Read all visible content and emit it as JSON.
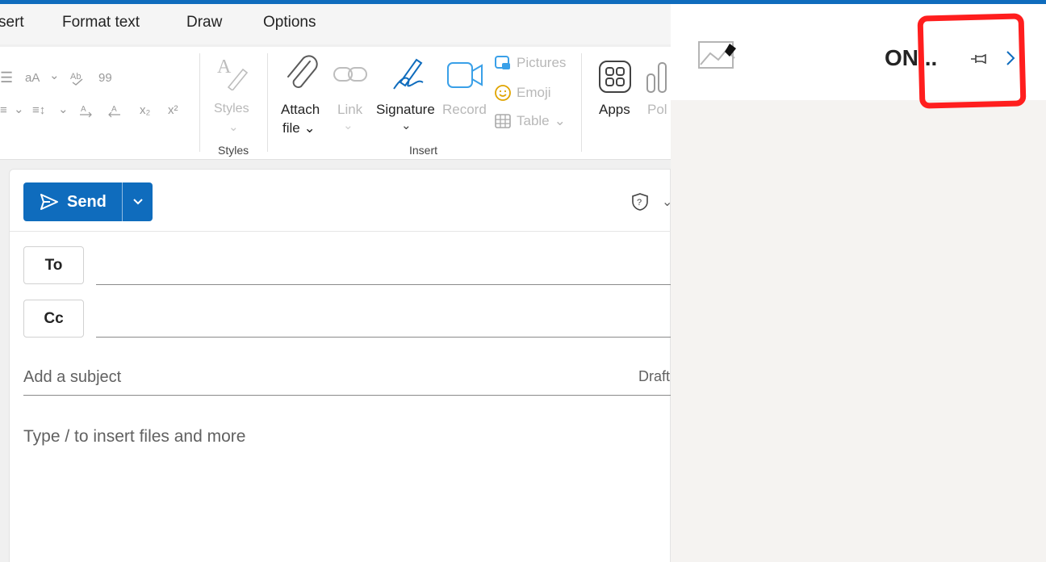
{
  "tabs": [
    {
      "label": "sert"
    },
    {
      "label": "Format text"
    },
    {
      "label": "Draw"
    },
    {
      "label": "Options"
    }
  ],
  "ribbon": {
    "format_glyphs": {
      "font_size": "aA",
      "chevron": "⌄",
      "quote": "99",
      "subscript": "x₂",
      "superscript": "x²"
    },
    "styles": {
      "label": "Styles",
      "group": "Styles"
    },
    "insert": {
      "attach_line1": "Attach",
      "attach_line2": "file",
      "link": "Link",
      "signature": "Signature",
      "record": "Record",
      "pictures": "Pictures",
      "emoji": "Emoji",
      "table": "Table",
      "group": "Insert"
    },
    "apps": "Apps",
    "poll": "Pol"
  },
  "compose": {
    "send_label": "Send",
    "to_label": "To",
    "cc_label": "Cc",
    "subject_placeholder": "Add a subject",
    "draft_label": "Draft",
    "body_placeholder": "Type / to insert files and more"
  },
  "panel": {
    "title": "ON..."
  },
  "colors": {
    "accent": "#0f6cbd",
    "annotation": "#ff1e1e"
  },
  "icons": {
    "send": "send-icon",
    "pin": "pin-icon",
    "close": "chevron-right-icon",
    "sensitivity": "shield-question-icon",
    "image": "image-icon"
  }
}
